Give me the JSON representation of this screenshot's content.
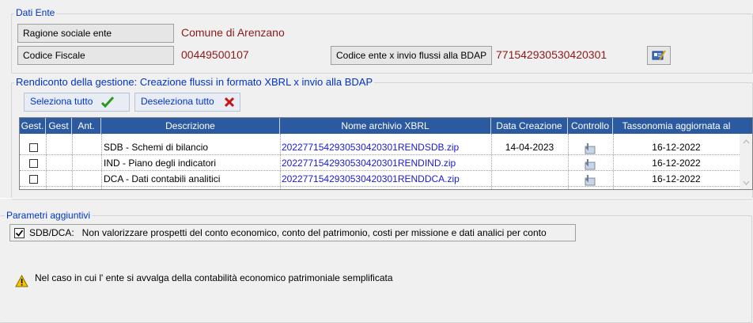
{
  "dati_ente": {
    "legend": "Dati Ente",
    "ragione_label": "Ragione sociale ente",
    "ragione_value": "Comune di Arenzano",
    "cf_label": "Codice Fiscale",
    "cf_value": "00449500107",
    "codice_label": "Codice ente x invio flussi alla BDAP",
    "codice_value": "771542930530420301",
    "edit_icon": "edit-card-icon"
  },
  "rendiconto": {
    "legend": "Rendiconto della gestione: Creazione flussi in formato XBRL x invio alla BDAP",
    "select_all": "Seleziona tutto",
    "deselect_all": "Deseleziona tutto",
    "columns": [
      "Gest.",
      "Gest",
      "Ant.",
      "Descrizione",
      "Nome archivio XBRL",
      "Data Creazione",
      "Controllo",
      "Tassonomia  aggiornata al"
    ],
    "rows": [
      {
        "descrizione": "SDB - Schemi di bilancio",
        "archivio": "2022771542930530420301RENDSDB.zip",
        "data": "14-04-2023",
        "tassonomia": "16-12-2022"
      },
      {
        "descrizione": "IND - Piano degli indicatori",
        "archivio": "2022771542930530420301RENDIND.zip",
        "data": "",
        "tassonomia": "16-12-2022"
      },
      {
        "descrizione": "DCA - Dati contabili analitici",
        "archivio": "2022771542930530420301RENDDCA.zip",
        "data": "",
        "tassonomia": "16-12-2022"
      }
    ]
  },
  "parametri": {
    "legend": "Parametri aggiuntivi",
    "option_label": "SDB/DCA:   Non valorizzare prospetti del conto economico, conto del patrimonio, costi per missione e dati analici per conto",
    "option_checked": true,
    "warning_text": "Nel caso in cui l' ente si avvalga della contabilità economico patrimoniale semplificata"
  },
  "colors": {
    "accent": "#0033cc",
    "value": "#8b1a1a",
    "header": "#2c5aa0"
  }
}
